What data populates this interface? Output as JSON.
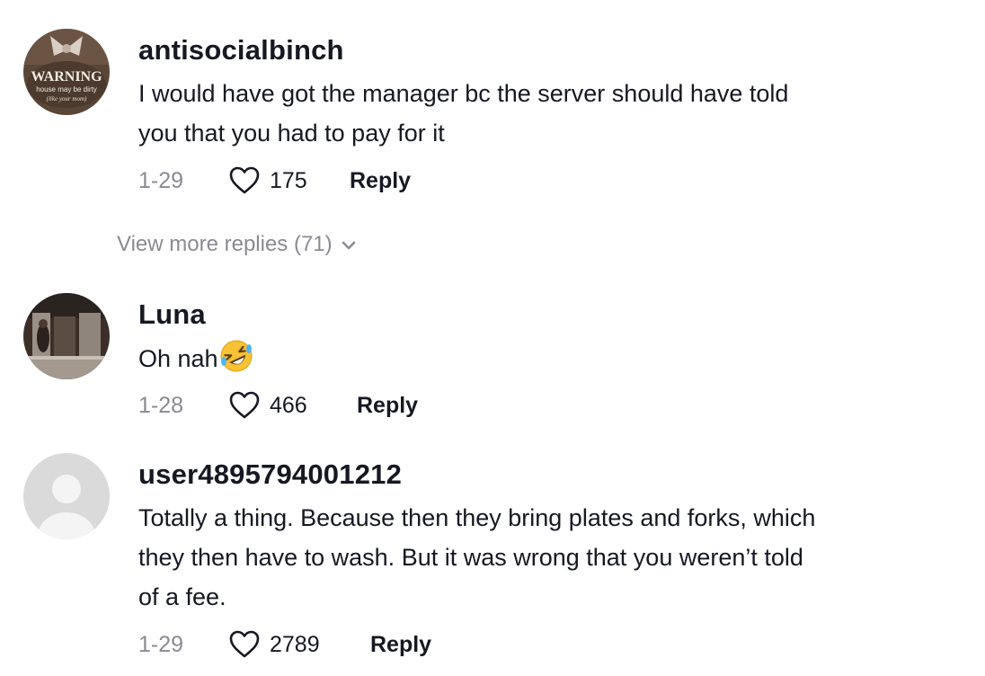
{
  "comments": [
    {
      "username": "antisocialbinch",
      "avatar_text": {
        "line1": "WARNING",
        "line2": "house may be dirty",
        "line3": "(like your mom)"
      },
      "text_lines": [
        "I would have got the manager bc the server should have told",
        "you that you had to pay for it"
      ],
      "date": "1-29",
      "likes": "175",
      "reply_label": "Reply"
    },
    {
      "username": "Luna",
      "text": "Oh nah",
      "emoji": "rolling-on-floor-laughing",
      "date": "1-28",
      "likes": "466",
      "reply_label": "Reply"
    },
    {
      "username": "user4895794001212",
      "text_lines": [
        "Totally a thing. Because then they bring plates and forks, which",
        "they then have to wash. But it was wrong that you weren’t told",
        "of a fee."
      ],
      "date": "1-29",
      "likes": "2789",
      "reply_label": "Reply"
    }
  ],
  "view_more": {
    "label": "View more replies (71)",
    "icon": "chevron-down-icon"
  },
  "colors": {
    "text": "#161823",
    "muted": "#8a8b91",
    "background": "#ffffff"
  }
}
